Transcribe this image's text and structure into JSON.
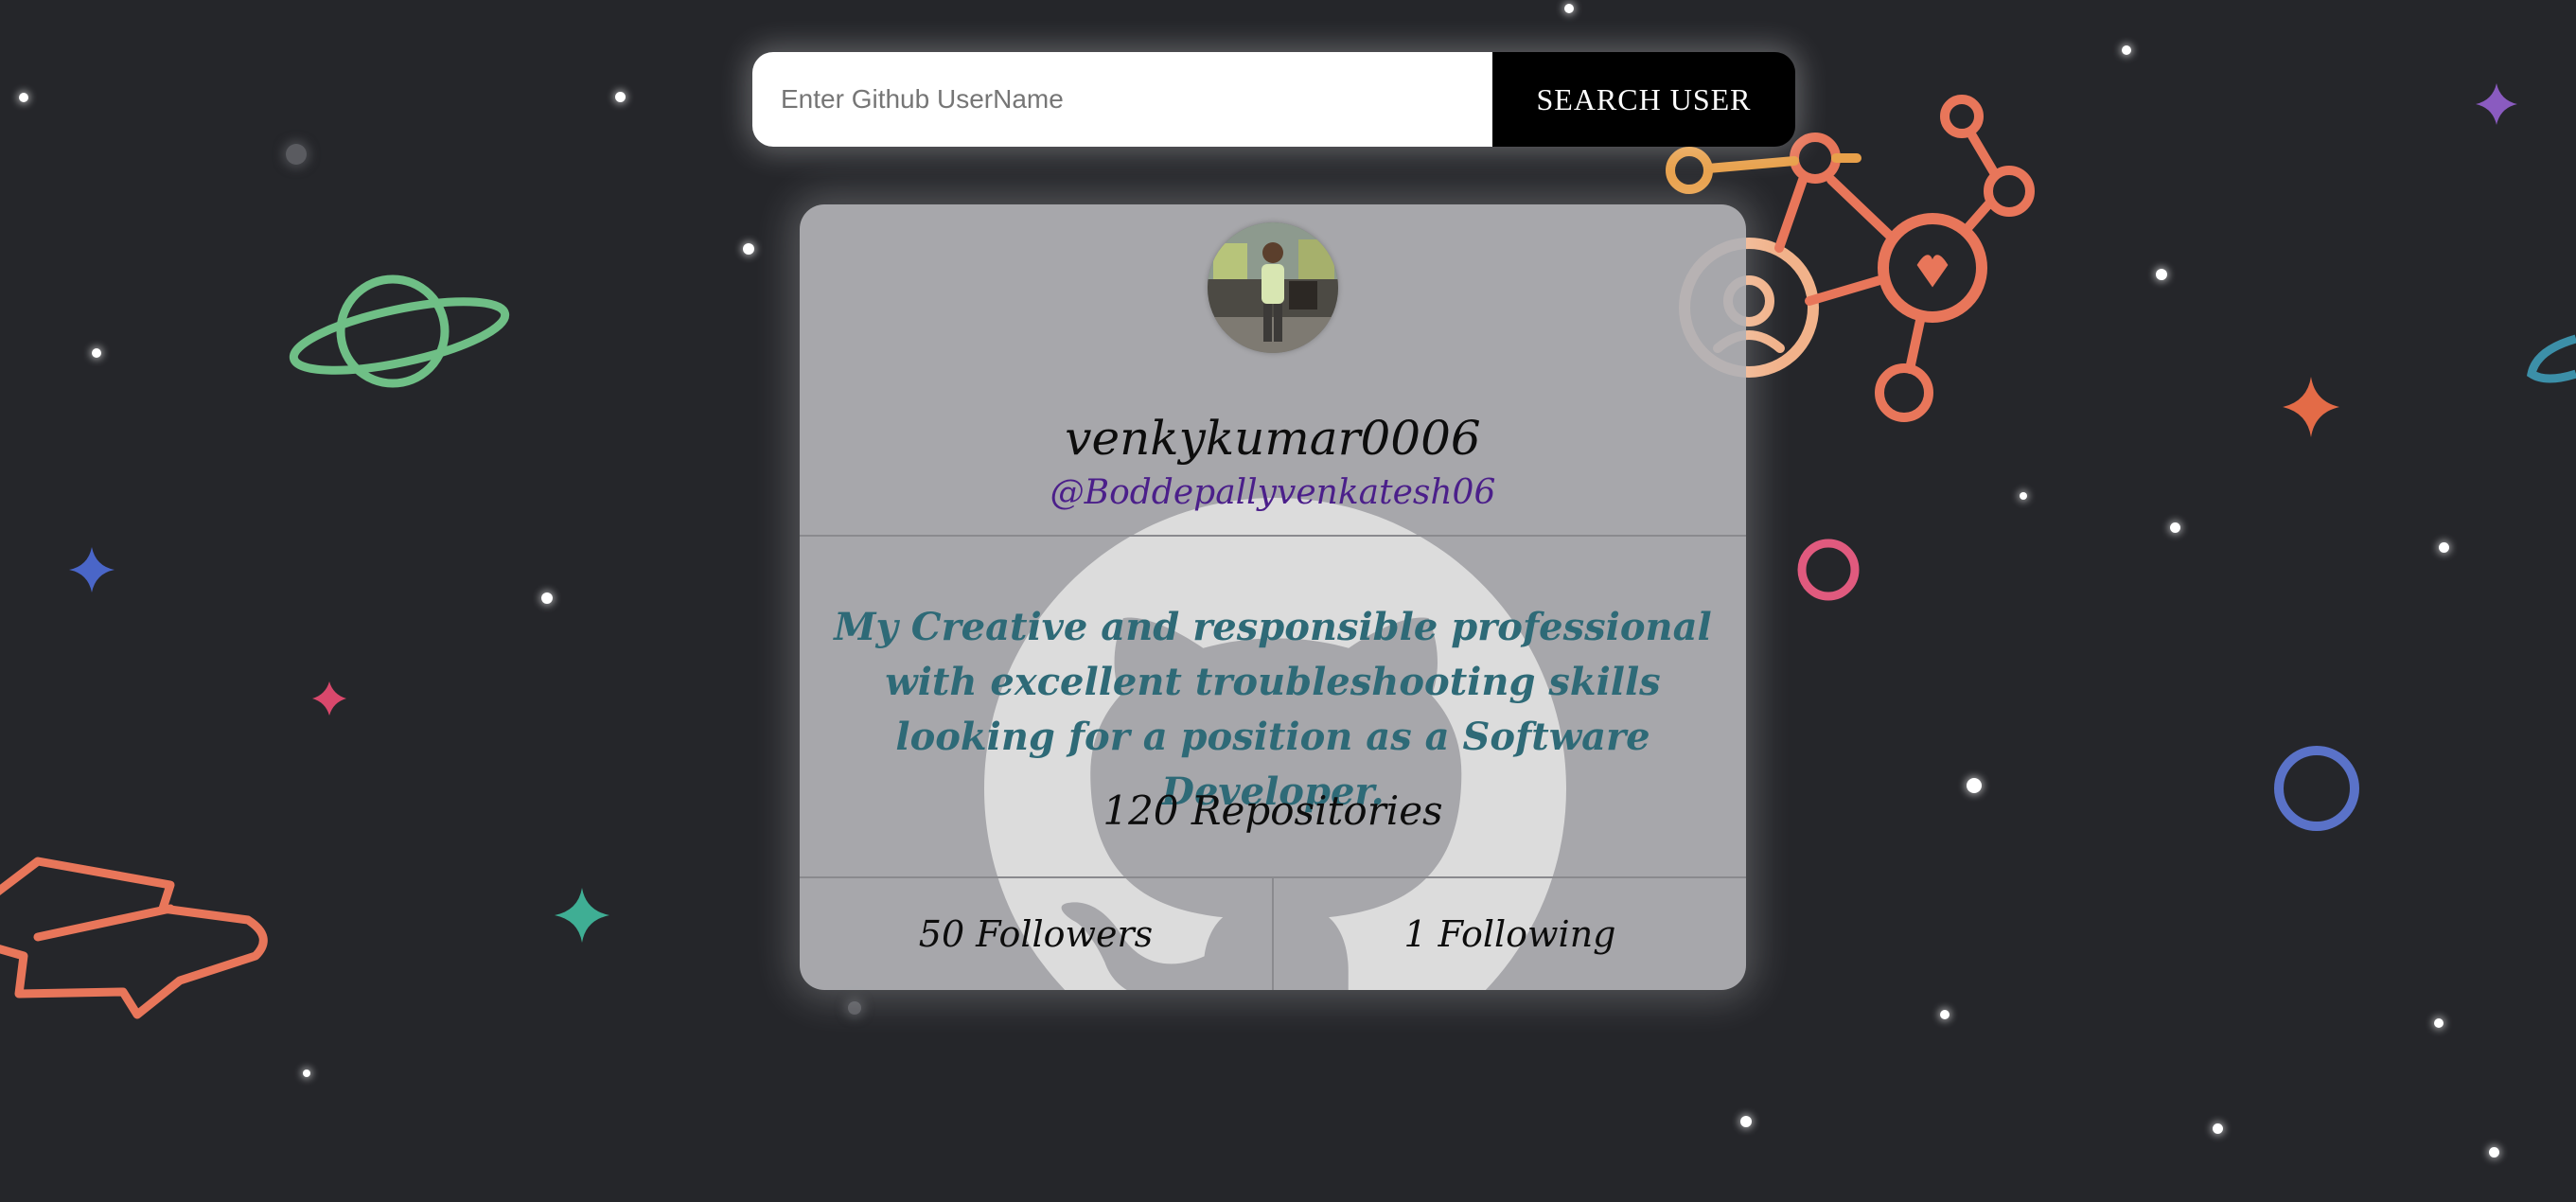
{
  "search": {
    "placeholder": "Enter Github UserName",
    "value": "",
    "button_label": "SEARCH USER"
  },
  "profile": {
    "avatar_icon": "user-avatar-photo",
    "name": "venkykumar0006",
    "handle": "@Boddepallyvenkatesh06",
    "bio": "My Creative and responsible professional with excellent troubleshooting skills looking for a position as a Software Developer.",
    "repositories_count": "120",
    "repositories_label": "Repositories",
    "followers_count": "50",
    "followers_label": "Followers",
    "following_count": "1",
    "following_label": "Following"
  },
  "background": {
    "theme": "github-space-doodles",
    "icons": [
      "planet-icon",
      "network-icon",
      "spaceship-icon",
      "sparkle-icon",
      "ring-icon",
      "github-octocat-icon"
    ]
  },
  "colors": {
    "page_bg": "#25262a",
    "card_bg": "#b2b2b6",
    "bio_text": "#2e6a77",
    "handle_text": "#4b1f8a",
    "button_bg": "#000000",
    "planet": "#6fbf86",
    "network": "#e8765a",
    "ring_pink": "#e05a7e",
    "ring_blue": "#5a72c8"
  }
}
